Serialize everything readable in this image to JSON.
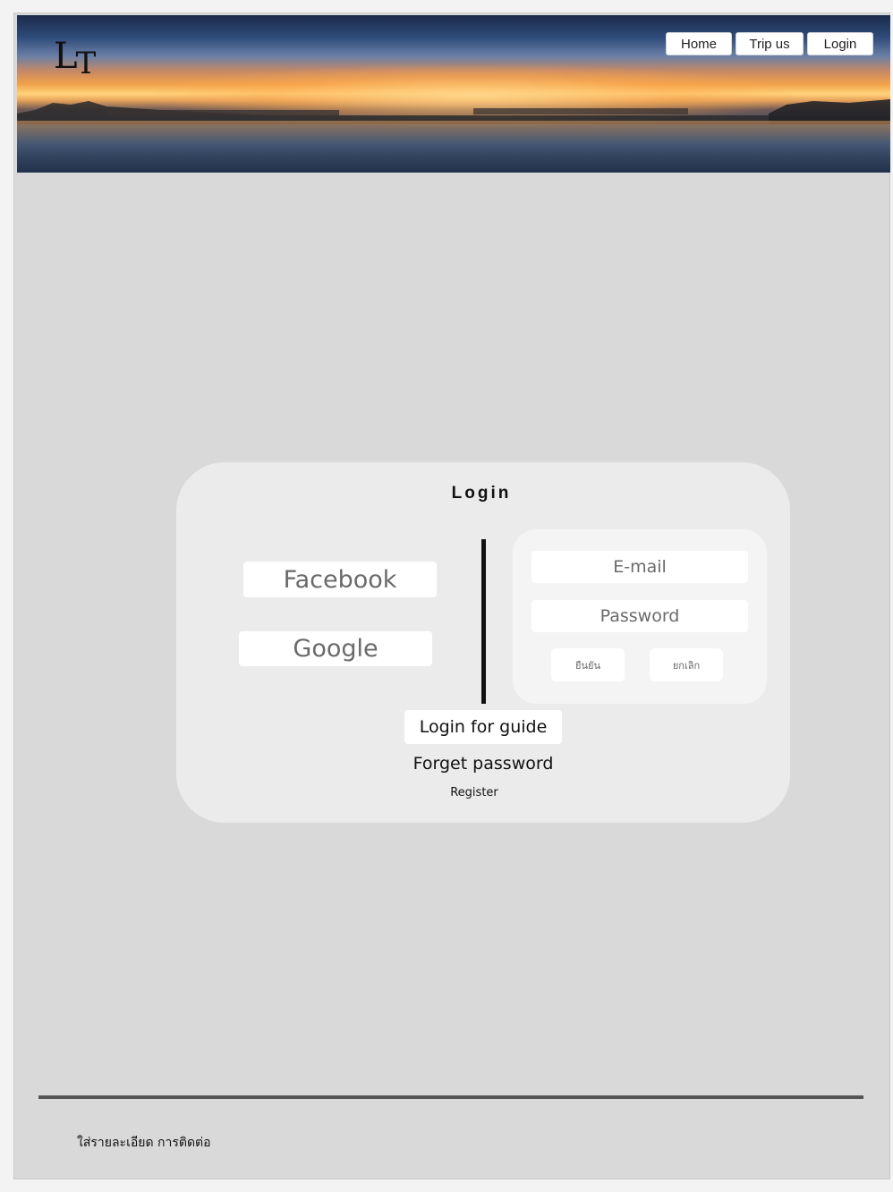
{
  "header": {
    "logo_main": "L",
    "logo_sub": "T",
    "nav": [
      {
        "label": "Home"
      },
      {
        "label": "Trip us"
      },
      {
        "label": "Login"
      }
    ]
  },
  "login_card": {
    "title": "Login",
    "facebook_label": "Facebook",
    "google_label": "Google",
    "email_placeholder": "E-mail",
    "password_placeholder": "Password",
    "confirm_label": "ยืนยัน",
    "cancel_label": "ยกเลิก",
    "guide_login_label": "Login for guide",
    "forget_password_label": "Forget password",
    "register_label": "Register"
  },
  "footer": {
    "contact_text": "ใส่รายละเอียด การติดต่อ"
  },
  "colors": {
    "page_background": "#d9d9d9",
    "card_background": "#ebebeb",
    "button_background": "#ffffff",
    "divider": "#111111",
    "footer_line": "#555555"
  }
}
